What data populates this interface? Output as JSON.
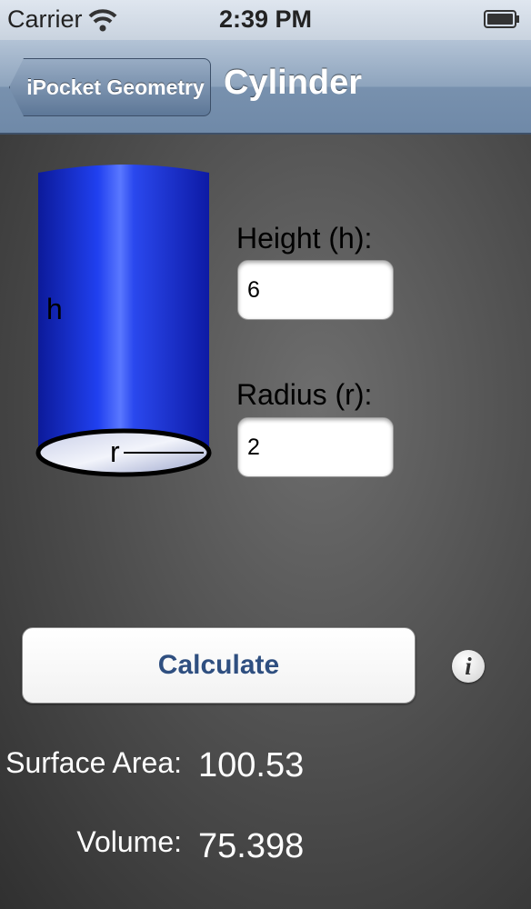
{
  "status_bar": {
    "carrier": "Carrier",
    "time": "2:39 PM"
  },
  "nav": {
    "back_label": "iPocket Geometry",
    "title": "Cylinder"
  },
  "diagram": {
    "height_label": "h",
    "radius_label": "r"
  },
  "fields": {
    "height_label": "Height (h):",
    "height_value": "6",
    "radius_label": "Radius (r):",
    "radius_value": "2"
  },
  "actions": {
    "calculate_label": "Calculate",
    "info_icon": "i"
  },
  "results": {
    "surface_area_label": "Surface Area:",
    "surface_area_value": "100.53",
    "volume_label": "Volume:",
    "volume_value": "75.398"
  },
  "colors": {
    "cylinder": "#1a2fd0",
    "calculate_text": "#2f4f80"
  }
}
